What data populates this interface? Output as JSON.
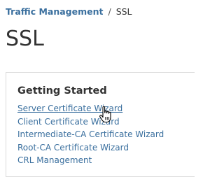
{
  "breadcrumb": {
    "parent": "Traffic Management",
    "separator": "/",
    "current": "SSL"
  },
  "page_title": "SSL",
  "getting_started": {
    "heading": "Getting Started",
    "links": [
      {
        "label": "Server Certificate Wizard",
        "hovered": true
      },
      {
        "label": "Client Certificate Wizard"
      },
      {
        "label": "Intermediate-CA Certificate Wizard"
      },
      {
        "label": "Root-CA Certificate Wizard"
      },
      {
        "label": "CRL Management"
      }
    ]
  },
  "colors": {
    "link": "#3a6f9e",
    "text": "#333333",
    "panel_border": "#dcdcdc"
  },
  "cursor": "hand-pointer-icon"
}
